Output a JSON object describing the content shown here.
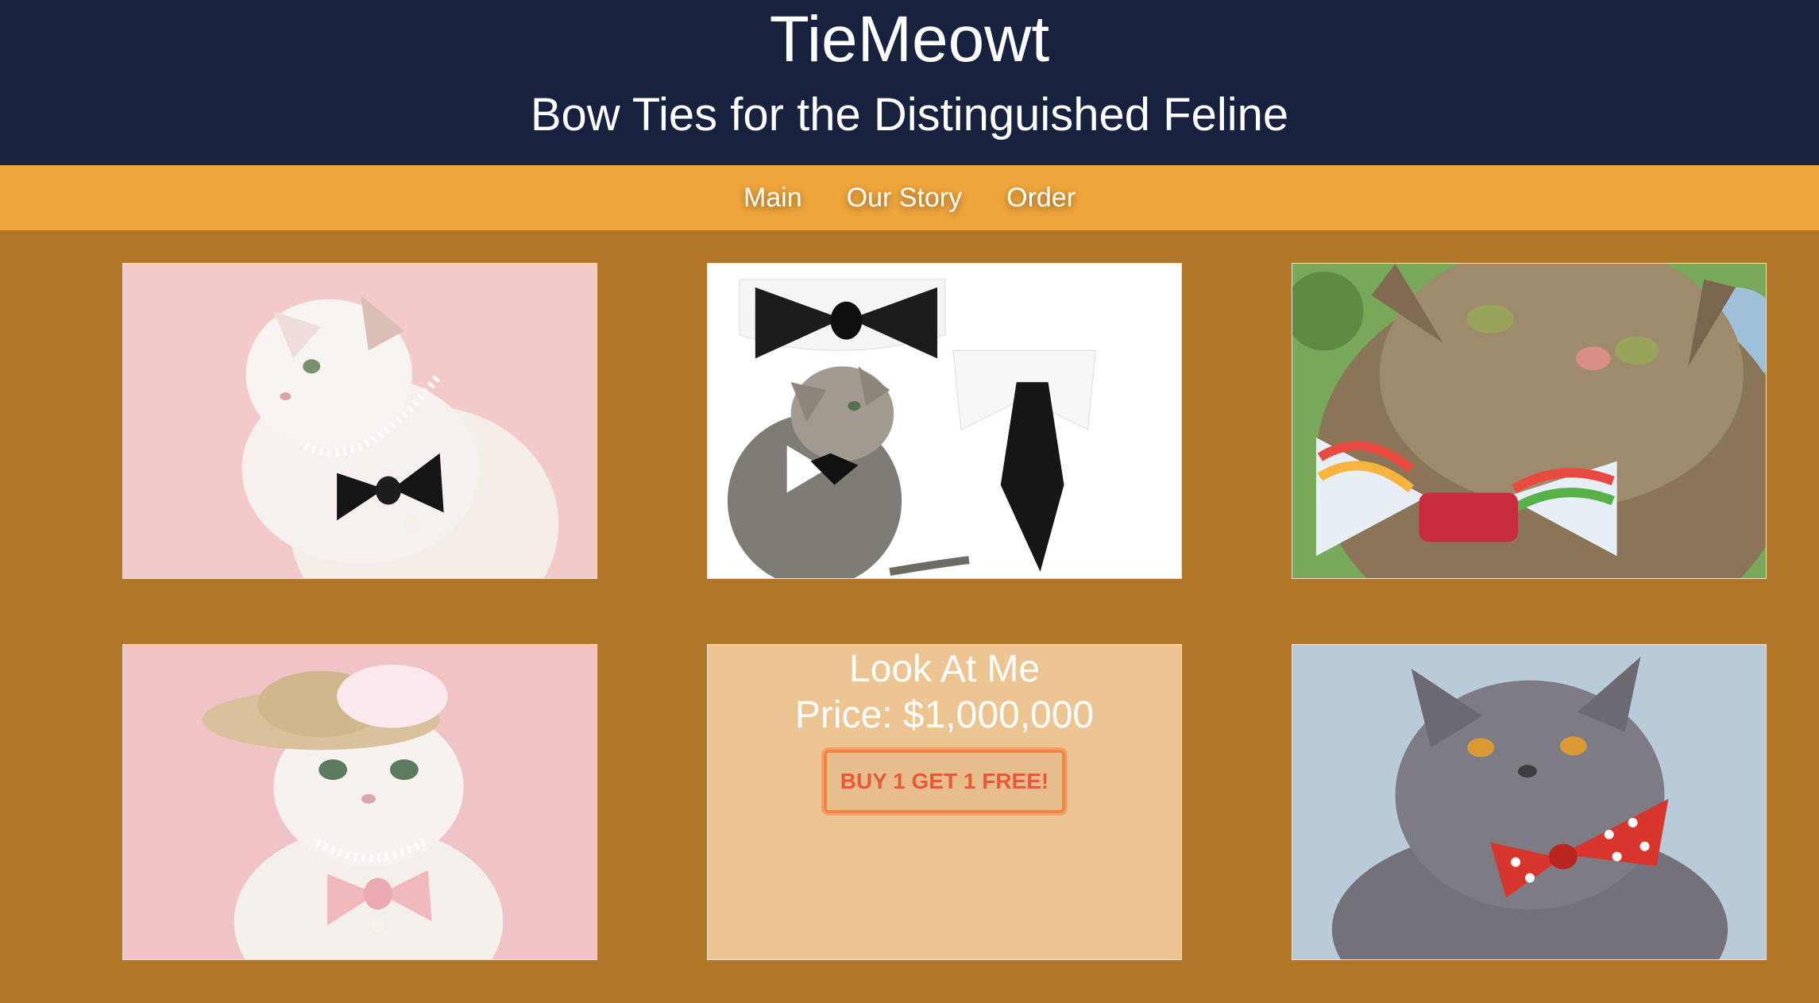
{
  "header": {
    "title": "TieMeowt",
    "tagline": "Bow Ties for the Distinguished Feline"
  },
  "nav": {
    "items": [
      {
        "label": "Main"
      },
      {
        "label": "Our Story"
      },
      {
        "label": "Order"
      }
    ]
  },
  "gallery": {
    "images": [
      {
        "subject": "white cat with pearl necklace and black bow tie",
        "background": "#f3c9c9"
      },
      {
        "subject": "tabby cat with black bow tie and collar accessories",
        "background": "#ffffff"
      },
      {
        "subject": "tabby cat wearing rainbow bow tie",
        "background": "#7aa85a"
      },
      {
        "subject": "white cat with straw hat and pink bow tie",
        "background": "#f0c4c6"
      },
      {
        "subject": "grey cat with red polka dot bow tie",
        "background": "#b9cbd8"
      }
    ]
  },
  "product": {
    "name": "Look At Me",
    "price": "Price: $1,000,000",
    "promo_button": "BUY 1 GET 1 FREE!"
  },
  "colors": {
    "header_bg": "#18213d",
    "nav_bg": "#efa53c",
    "page_bg": "#b17726",
    "card_bg": "#ecc593",
    "button_text": "#e8593a"
  }
}
